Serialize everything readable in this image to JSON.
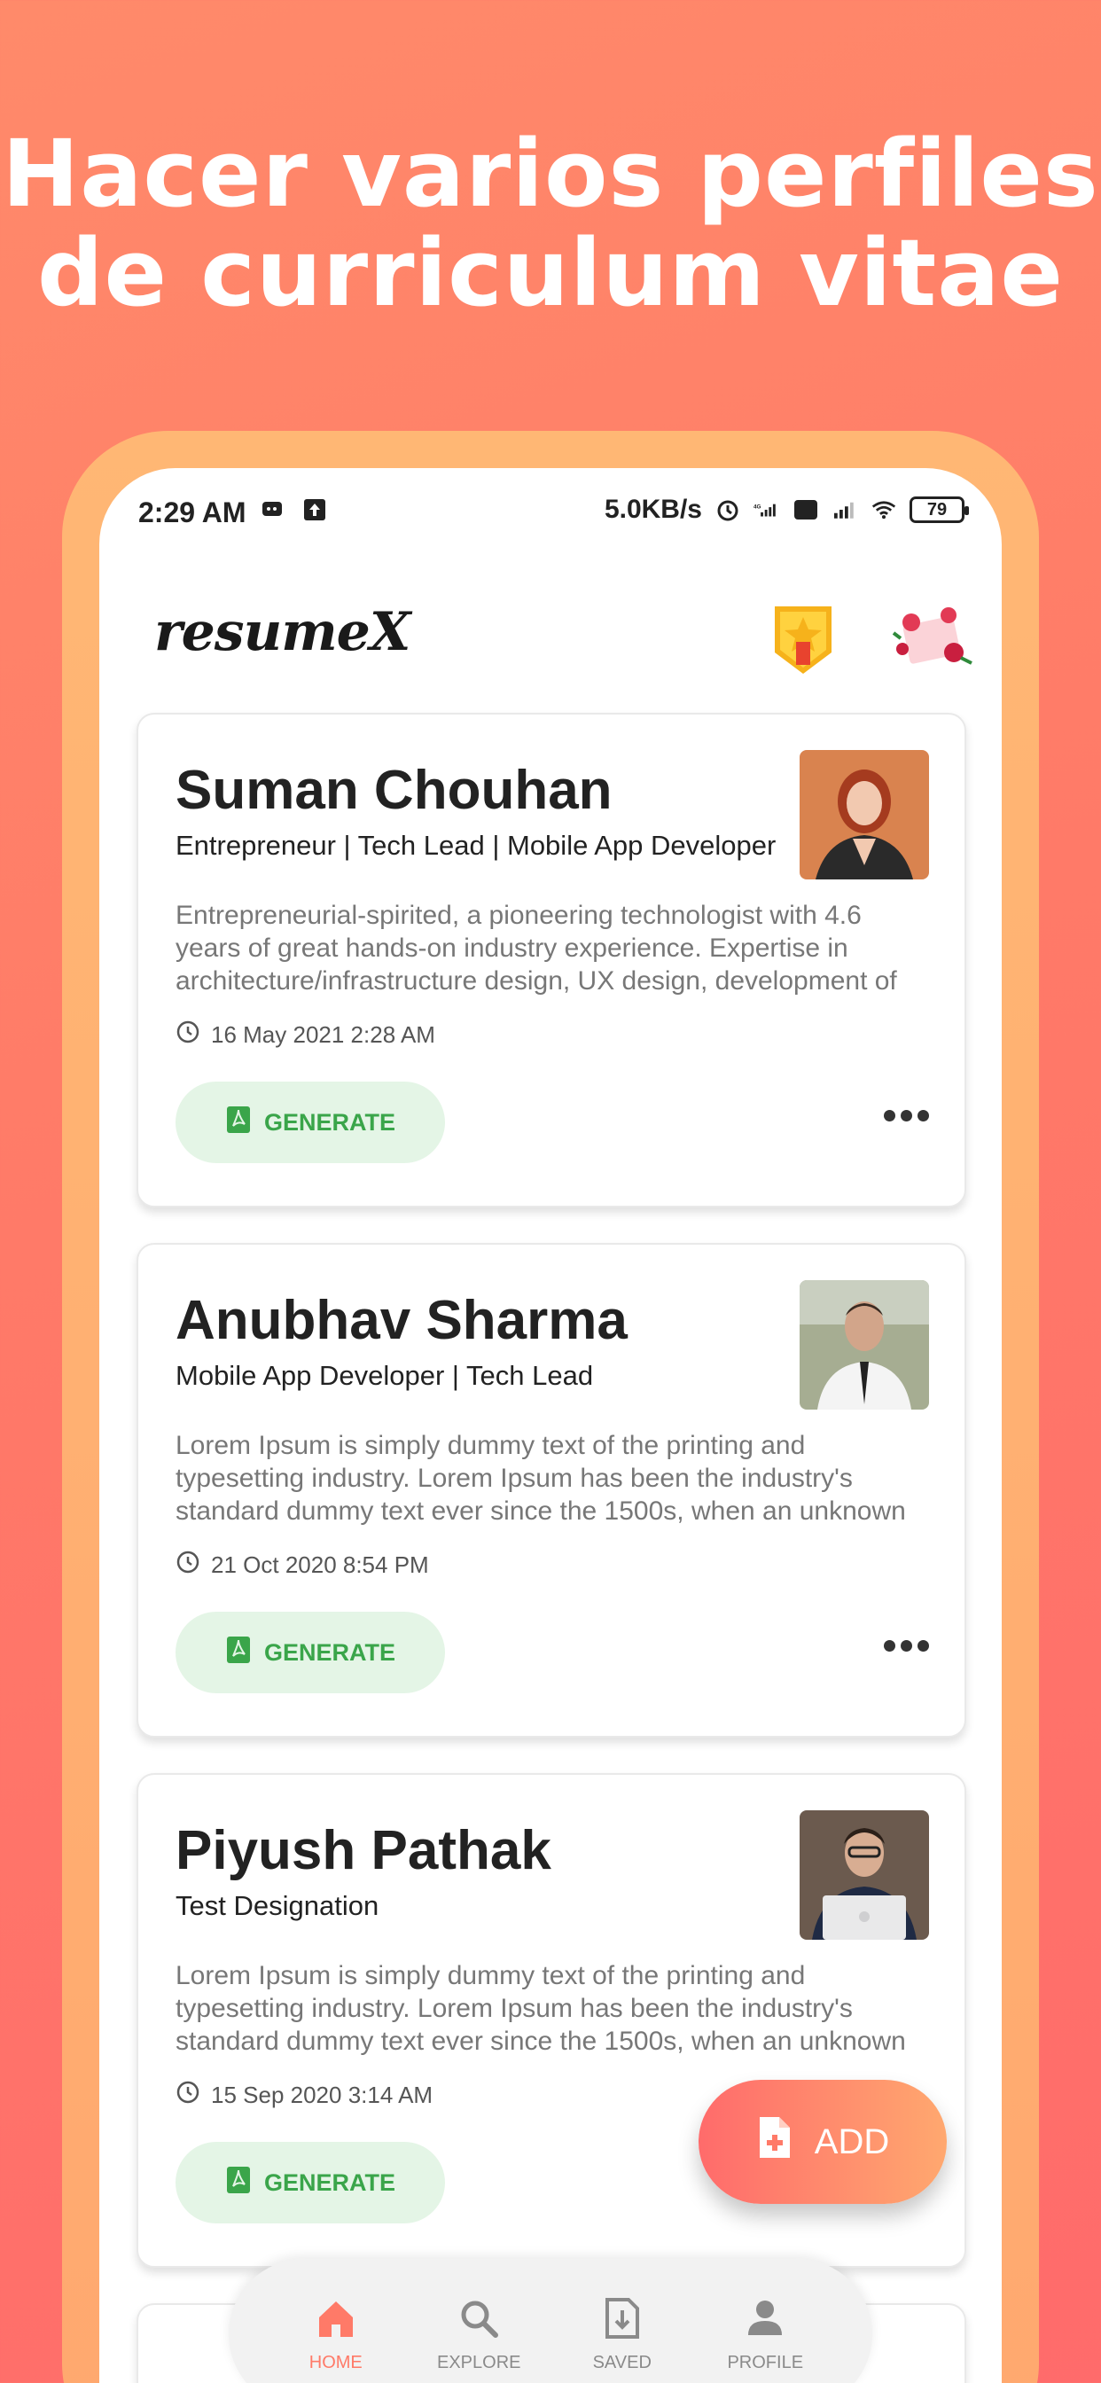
{
  "headline": {
    "line1": "Hacer varios perfiles",
    "line2": "de curriculum vitae"
  },
  "status_bar": {
    "time": "2:29 AM",
    "speed": "5.0KB/s",
    "battery": "79",
    "icons": [
      "message-icon",
      "upload-icon",
      "alarm-icon",
      "signal-4g-icon",
      "volte-icon",
      "signal-icon",
      "wifi-icon",
      "battery-icon"
    ]
  },
  "app_bar": {
    "logo": "resumeX",
    "icons": [
      "premium-badge-icon",
      "gift-icon"
    ]
  },
  "resumes": [
    {
      "name": "Suman Chouhan",
      "designation": "Entrepreneur | Tech Lead | Mobile App Developer",
      "summary": "Entrepreneurial-spirited, a pioneering technologist with 4.6 years of great hands-on industry experience. Expertise in architecture/infrastructure design, UX design, development of",
      "date": "16 May 2021 2:28 AM",
      "generate_label": "GENERATE",
      "photo_color": "#c56a3c"
    },
    {
      "name": "Anubhav Sharma",
      "designation": "Mobile App Developer | Tech Lead",
      "summary": "Lorem Ipsum is simply dummy text of the printing and typesetting industry. Lorem Ipsum has been the industry's standard dummy text ever since the 1500s, when an unknown",
      "date": "21 Oct 2020 8:54 PM",
      "generate_label": "GENERATE",
      "photo_color": "#9aa38a"
    },
    {
      "name": "Piyush Pathak",
      "designation": "Test Designation",
      "summary": "Lorem Ipsum is simply dummy text of the printing and typesetting industry. Lorem Ipsum has been the industry's standard dummy text ever since the 1500s, when an unknown",
      "date": "15 Sep 2020 3:14 AM",
      "generate_label": "GENERATE",
      "photo_color": "#7d6a5c"
    }
  ],
  "fab": {
    "label": "ADD"
  },
  "bottom_nav": [
    {
      "label": "HOME",
      "icon": "home-icon",
      "active": true
    },
    {
      "label": "EXPLORE",
      "icon": "search-icon",
      "active": false
    },
    {
      "label": "SAVED",
      "icon": "download-icon",
      "active": false
    },
    {
      "label": "PROFILE",
      "icon": "person-icon",
      "active": false
    }
  ],
  "colors": {
    "accent": "#ff7a68",
    "generate_bg": "#e4f5e6",
    "generate_text": "#3aa54a"
  }
}
